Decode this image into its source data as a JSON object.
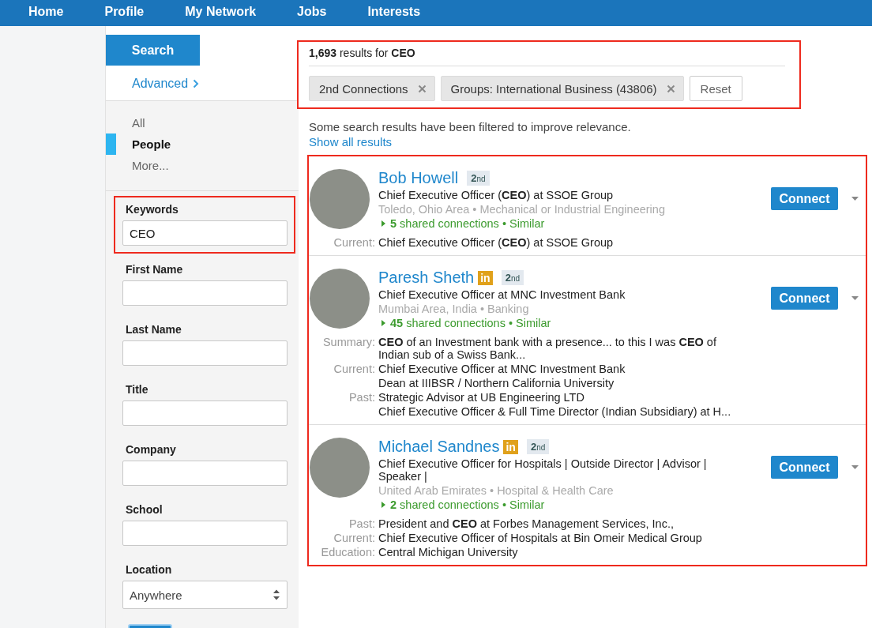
{
  "nav": [
    {
      "label": "Home"
    },
    {
      "label": "Profile"
    },
    {
      "label": "My Network"
    },
    {
      "label": "Jobs"
    },
    {
      "label": "Interests"
    }
  ],
  "sidebar": {
    "tabs": [
      {
        "label": "Search",
        "selected": true
      }
    ],
    "advanced_link": "Advanced",
    "categories": [
      {
        "label": "All",
        "selected": false
      },
      {
        "label": "People",
        "selected": true
      },
      {
        "label": "More...",
        "selected": false
      }
    ],
    "fields": [
      {
        "kind": "text",
        "label": "Keywords",
        "value": "CEO",
        "highlighted": true
      },
      {
        "kind": "text",
        "label": "First Name",
        "highlighted": false
      },
      {
        "kind": "text",
        "label": "Last Name",
        "highlighted": false
      },
      {
        "kind": "text",
        "label": "Title",
        "highlighted": false
      },
      {
        "kind": "text",
        "label": "Company",
        "highlighted": false
      },
      {
        "kind": "text",
        "label": "School",
        "highlighted": false
      },
      {
        "kind": "select",
        "label": "Location",
        "value": "Anywhere",
        "highlighted": false
      }
    ]
  },
  "results_header": {
    "highlighted": true,
    "summary": "**1,693** results for **CEO**",
    "filters": [
      {
        "label": "2nd Connections"
      },
      {
        "label": "Groups: International Business (43806)"
      }
    ],
    "reset": "Reset"
  },
  "notice": "Some search results have been filtered to improve relevance.",
  "show_all_link": "Show all results",
  "results": {
    "highlighted": true,
    "items": [
      {
        "name": "Bob Howell",
        "degree": "**2**nd",
        "headline": "Chief Executive Officer (**CEO**) at SSOE Group",
        "meta": "Toledo, Ohio Area • Mechanical or Industrial Engineering",
        "shared": "**5** shared connections • Similar",
        "button": "Connect",
        "details": [
          {
            "label": "Current:",
            "lines": [
              "Chief Executive Officer (**CEO**) at SSOE Group"
            ]
          }
        ]
      },
      {
        "name": "Paresh Sheth",
        "badge": "in",
        "degree": "**2**nd",
        "headline": "Chief Executive Officer at MNC Investment Bank",
        "meta": "Mumbai Area, India • Banking",
        "shared": "**45** shared connections • Similar",
        "button": "Connect",
        "details": [
          {
            "label": "Summary:",
            "lines": [
              "**CEO** of an Investment bank with a presence... to this I was **CEO** of Indian sub of a Swiss Bank..."
            ]
          },
          {
            "label": "Current:",
            "lines": [
              "Chief Executive Officer at MNC Investment Bank",
              "Dean at IIIBSR / Northern California University"
            ]
          },
          {
            "label": "Past:",
            "lines": [
              "Strategic Advisor at UB Engineering LTD",
              "Chief Executive Officer & Full Time Director (Indian Subsidiary) at H..."
            ]
          }
        ]
      },
      {
        "name": "Michael Sandnes",
        "badge": "in",
        "degree": "**2**nd",
        "headline": "Chief Executive Officer for Hospitals | Outside Director | Advisor | Speaker |",
        "meta": "United Arab Emirates • Hospital & Health Care",
        "shared": "**2** shared connections • Similar",
        "button": "Connect",
        "details": [
          {
            "label": "Past:",
            "lines": [
              "President and **CEO** at Forbes Management Services, Inc.,"
            ]
          },
          {
            "label": "Current:",
            "lines": [
              "Chief Executive Officer of Hospitals at Bin Omeir Medical Group"
            ]
          },
          {
            "label": "Education:",
            "lines": [
              "Central Michigan University"
            ]
          }
        ]
      }
    ]
  }
}
